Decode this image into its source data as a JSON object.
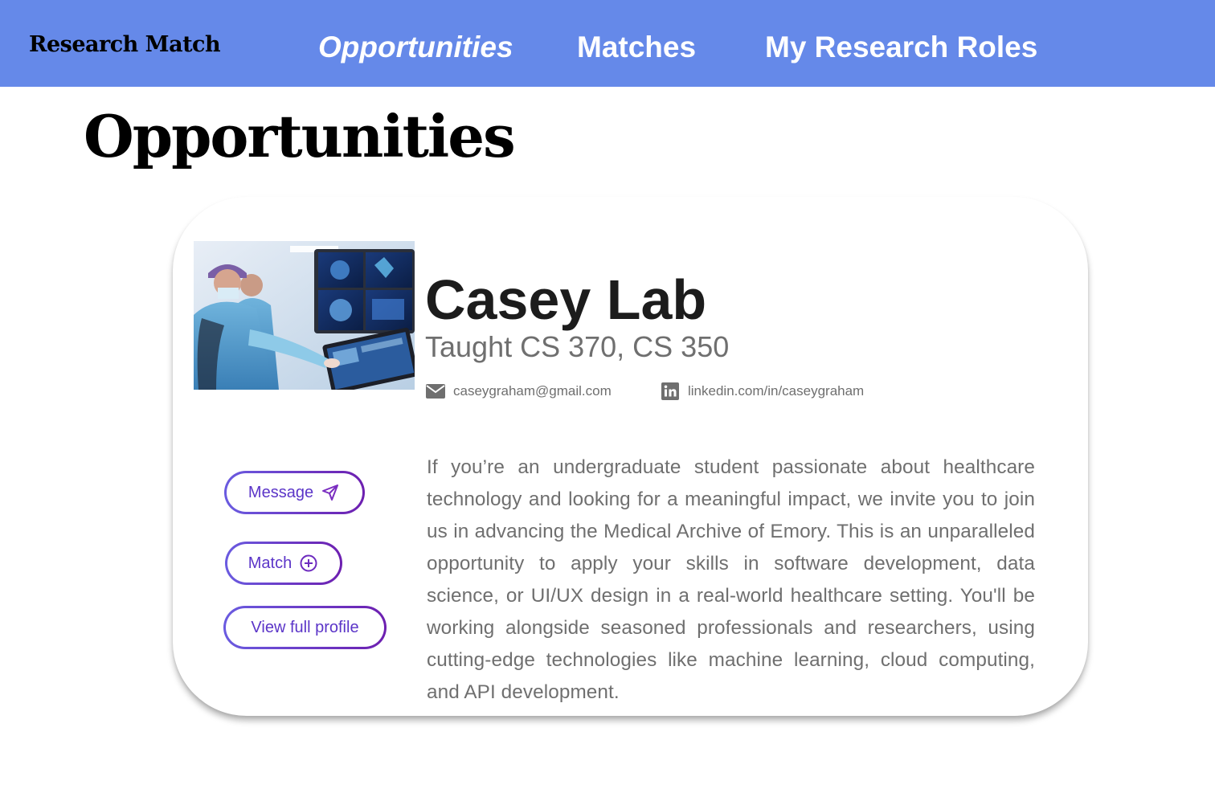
{
  "app": {
    "brand": "Research Match"
  },
  "nav": {
    "items": [
      {
        "label": "Opportunities",
        "active": true
      },
      {
        "label": "Matches",
        "active": false
      },
      {
        "label": "My Research Roles",
        "active": false
      }
    ]
  },
  "page": {
    "title": "Opportunities"
  },
  "card": {
    "name": "Casey Lab",
    "subtitle": "Taught CS 370, CS 350",
    "email": "caseygraham@gmail.com",
    "linkedin": "linkedin.com/in/caseygraham",
    "photo_icon": "lab-photo",
    "buttons": {
      "message": "Message",
      "match": "Match",
      "profile": "View full profile"
    },
    "description": "If you’re an undergraduate student passionate about healthcare technology and looking for a meaningful impact, we invite you to join us in advancing the Medical Archive of Emory. This is an unparalleled opportunity to apply your skills in software development, data science, or UI/UX design in a real-world healthcare setting. You'll be working alongside seasoned professionals and researchers, using cutting-edge technologies like machine learning, cloud computing, and API development."
  },
  "colors": {
    "navbar": "#6589e9",
    "button_gradient_start": "#6a5be0",
    "button_gradient_end": "#6d1fb0",
    "muted_text": "#6f6f6f"
  },
  "icons": {
    "email": "envelope-icon",
    "linkedin": "linkedin-icon",
    "message": "paper-plane-icon",
    "match": "plus-circle-icon"
  }
}
